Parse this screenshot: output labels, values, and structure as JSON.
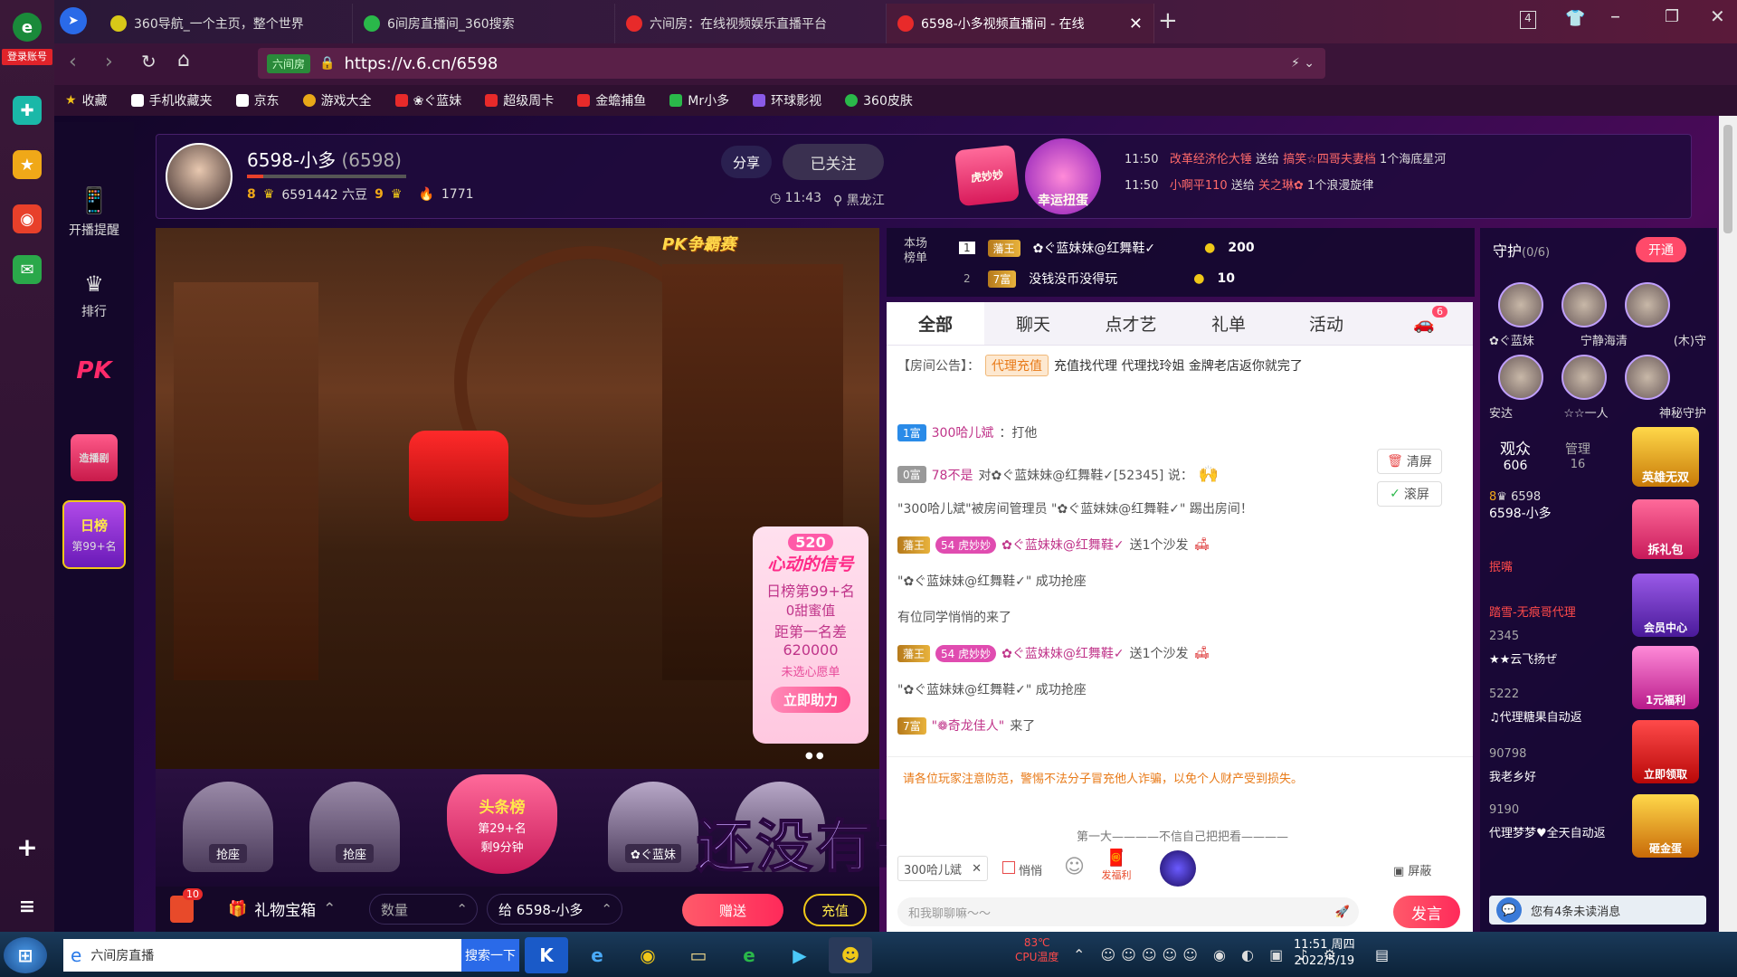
{
  "browser": {
    "login_label": "登录账号",
    "tabs": [
      {
        "label": "360导航_一个主页，整个世界"
      },
      {
        "label": "6间房直播间_360搜索"
      },
      {
        "label": "六间房：在线视频娱乐直播平台"
      },
      {
        "label": "6598-小多视频直播间 - 在线"
      }
    ],
    "new_tab": "+",
    "tab_count": "4",
    "address_tag": "六间房",
    "url": "https://v.6.cn/6598",
    "bookmarks": [
      "收藏",
      "手机收藏夹",
      "京东",
      "游戏大全",
      "❀ぐ蓝妹",
      "超级周卡",
      "金蟾捕鱼",
      "Mr小多",
      "环球影视",
      "360皮肤"
    ]
  },
  "site_sidebar": {
    "items": [
      {
        "label": "开播提醒",
        "icon": "phone-icon"
      },
      {
        "label": "排行",
        "icon": "crown-icon"
      },
      {
        "label": "PK",
        "icon": "pk-icon"
      },
      {
        "label": "造播剧",
        "icon": "gift-icon"
      },
      {
        "label": "日榜",
        "sub": "第99+名",
        "icon": "daily-rank-icon"
      }
    ]
  },
  "header": {
    "host_name": "6598-小多",
    "host_id": "(6598)",
    "level_left": "8",
    "beans": "6591442 六豆",
    "level_right": "9",
    "fans": "1771",
    "share_label": "分享",
    "follow_label": "已关注",
    "time": "11:43",
    "location": "黑龙江",
    "promo1": "虎妙妙",
    "promo2": "幸运扭蛋",
    "ticker": [
      {
        "time": "11:50",
        "from": "改革经济伦大锤",
        "verb": "送给",
        "to": "搞笑☆四哥夫妻档",
        "gift": "1个海底星河"
      },
      {
        "time": "11:50",
        "from": "小啊平110",
        "verb": "送给",
        "to": "关之琳✿",
        "gift": "1个浪漫旋律"
      }
    ]
  },
  "video": {
    "pk_banner": "PK争霸赛",
    "event_num": "520",
    "event_title": "心动的信号",
    "event_rank": "日榜第99+名",
    "event_sweet": "0甜蜜值",
    "event_gap_label": "距第一名差",
    "event_gap": "620000",
    "event_wish": "未选心愿单",
    "event_button": "立即助力"
  },
  "seats": {
    "seat1": "抢座",
    "seat2": "抢座",
    "headline_title": "头条榜",
    "headline_rank": "第29+名",
    "headline_time": "剩9分钟",
    "seat3": "✿ぐ蓝妹"
  },
  "lyric": "还没有歌词哦",
  "giftbar": {
    "box_count": "10",
    "treasure": "礼物宝箱",
    "qty_placeholder": "数量",
    "to_target": "给  6598-小多",
    "send": "赠送",
    "recharge": "充值"
  },
  "rank": {
    "title": "本场榜单",
    "rows": [
      {
        "n": "1",
        "badge": "藩王",
        "name": "✿ぐ蓝妹妹@红舞鞋✓",
        "coins": "200"
      },
      {
        "n": "2",
        "badge": "7富",
        "name": "没钱没币没得玩",
        "coins": "10"
      }
    ]
  },
  "chat": {
    "tabs": [
      "全部",
      "聊天",
      "点才艺",
      "礼单",
      "活动"
    ],
    "car_count": "6",
    "notice_label": "【房间公告】：",
    "notice_tag": "代理充值",
    "notice_text": "充值找代理 代理找玲姐 金牌老店返你就完了",
    "clear_label": "清屏",
    "scroll_label": "滚屏",
    "messages": [
      {
        "badge": "1富",
        "user": "300哈儿斌",
        "text": "：打他"
      },
      {
        "badge": "0富",
        "user": "78不是",
        "text": " 对✿ぐ蓝妹妹@红舞鞋✓[52345] 说："
      },
      {
        "text": "\"300哈儿斌\"被房间管理员 \"✿ぐ蓝妹妹@红舞鞋✓\" 踢出房间！"
      },
      {
        "badge": "藩王",
        "pink": "54 虎妙妙",
        "user": "✿ぐ蓝妹妹@红舞鞋✓",
        "text": "送1个沙发"
      },
      {
        "text": "\"✿ぐ蓝妹妹@红舞鞋✓\" 成功抢座"
      },
      {
        "text": "有位同学悄悄的来了"
      },
      {
        "badge": "藩王",
        "pink": "54 虎妙妙",
        "user": "✿ぐ蓝妹妹@红舞鞋✓",
        "text": "送1个沙发"
      },
      {
        "text": "\"✿ぐ蓝妹妹@红舞鞋✓\" 成功抢座"
      },
      {
        "badge": "7富",
        "user": "\"❁奇龙佳人\"",
        "text": "来了"
      }
    ],
    "warning": "请各位玩家注意防范，警惕不法分子冒充他人诈骗，以免个人财产受到损失。",
    "marquee": "第一大————不信自己把把看————",
    "target_user": "300哈儿斌",
    "whisper": "悄悄",
    "fuli": "发福利",
    "shield": "屏蔽",
    "input_placeholder": "和我聊聊嘛～～",
    "send_label": "发言"
  },
  "guard": {
    "title": "守护",
    "count": "(0/6)",
    "open": "开通",
    "names": [
      "✿ぐ蓝妹",
      "宁静海清",
      "(木)守",
      "安达",
      "☆☆一人",
      "神秘守护"
    ],
    "audience_label": "观众",
    "audience_count": "606",
    "manage_label": "管理",
    "manage_count": "16",
    "users": [
      {
        "lvl": "8",
        "id": "6598",
        "name": "6598-小多"
      },
      {
        "name": "抿嘴",
        "id": ""
      },
      {
        "name": "踏雪-无痕哥代理",
        "id": ""
      },
      {
        "name": "★★云飞扬ぜ",
        "id": "2345"
      },
      {
        "name": "♫代理糖果自动返",
        "id": "5222"
      },
      {
        "name": "我老乡好",
        "id": "90798"
      },
      {
        "name": "代理梦梦♥全天自动返",
        "id": "9190"
      }
    ],
    "promos": [
      "英雄无双",
      "拆礼包",
      "会员中心",
      "1元福利",
      "立即领取",
      "砸金蛋"
    ],
    "unread": "您有4条未读消息"
  },
  "taskbar": {
    "window_title": "六间房直播",
    "search": "搜索一下",
    "cpu_temp": "83℃",
    "cpu_label": "CPU温度",
    "time": "11:51 周四",
    "date": "2022/5/19"
  }
}
